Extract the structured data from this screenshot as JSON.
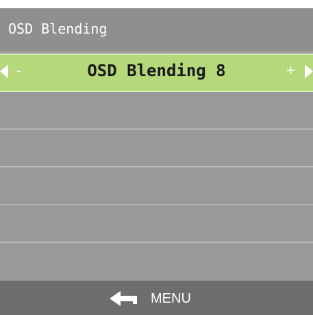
{
  "header_overflow_text": "",
  "menu": {
    "title": "OSD Blending",
    "selected_row": {
      "value": "OSD Blending 8",
      "decrement_symbol": "-",
      "increment_symbol": "+"
    },
    "empty_rows": [
      "",
      "",
      "",
      "",
      ""
    ]
  },
  "footer": {
    "back_icon": "return-arrow-icon",
    "label": "MENU"
  },
  "colors": {
    "panel_bg": "#999999",
    "title_bg": "#8f8f8f",
    "selected_bg": "#b4d87a",
    "footer_bg": "#6e6e6e",
    "text": "#ffffff"
  }
}
